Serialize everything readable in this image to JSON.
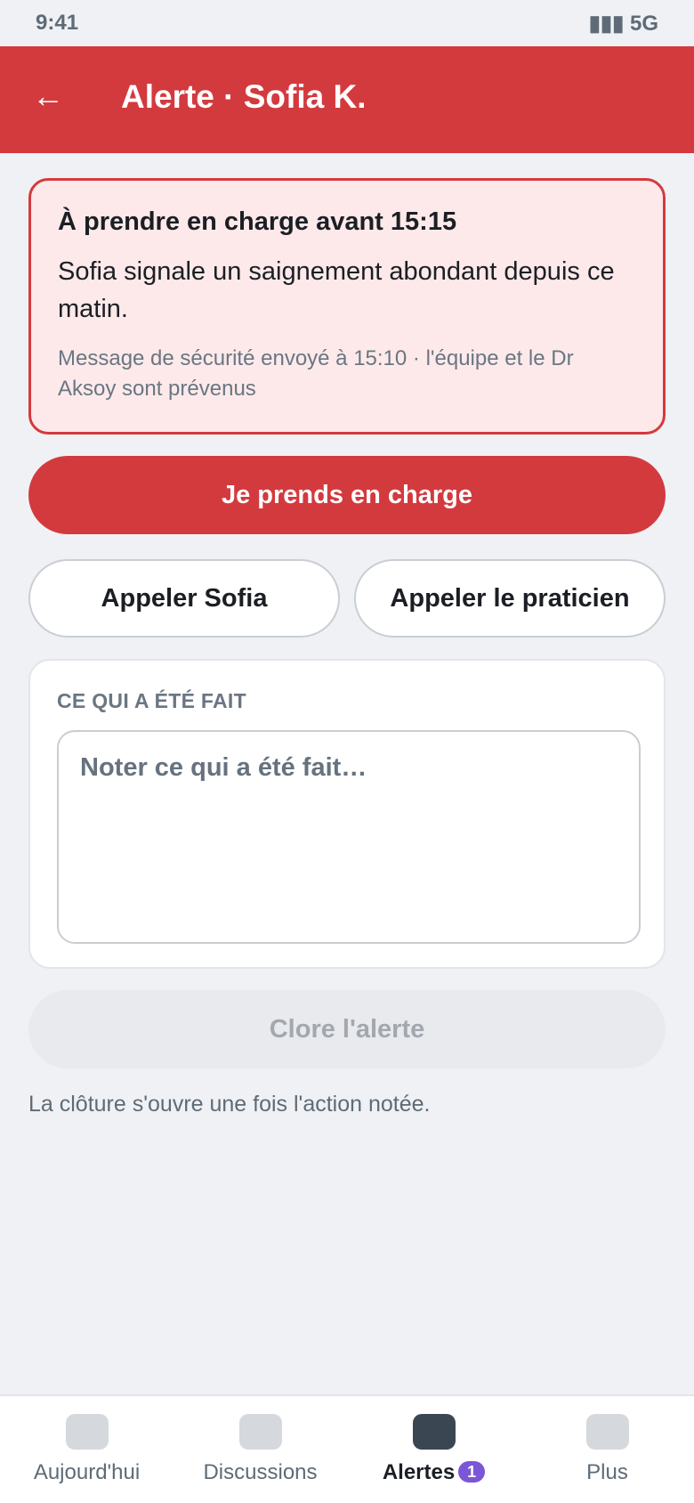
{
  "status_bar": {
    "time": "9:41",
    "signal": "▮▮▮ 5G"
  },
  "header": {
    "back_icon": "←",
    "title": "Alerte · Sofia K."
  },
  "alert": {
    "deadline": "À prendre en charge avant 15:15",
    "message": "Sofia signale un saignement abondant depuis ce matin.",
    "note": "Message de sécurité envoyé à 15:10 · l'équipe et le Dr Aksoy sont prévenus"
  },
  "actions": {
    "take_charge": "Je prends en charge",
    "call_patient": "Appeler Sofia",
    "call_doctor": "Appeler le praticien"
  },
  "notes": {
    "label": "CE QUI A ÉTÉ FAIT",
    "placeholder": "Noter ce qui a été fait…",
    "value": ""
  },
  "close": {
    "label": "Clore l'alerte",
    "helper": "La clôture s'ouvre une fois l'action notée."
  },
  "tabs": [
    {
      "label": "Aujourd'hui",
      "icon": "today-icon"
    },
    {
      "label": "Discussions",
      "icon": "chat-icon"
    },
    {
      "label": "Alertes",
      "icon": "alert-icon",
      "badge": "1",
      "active": true
    },
    {
      "label": "Plus",
      "icon": "more-icon"
    }
  ],
  "colors": {
    "accent": "#d33a3e",
    "alert_bg": "#fde9ea",
    "badge": "#7b56d6"
  }
}
